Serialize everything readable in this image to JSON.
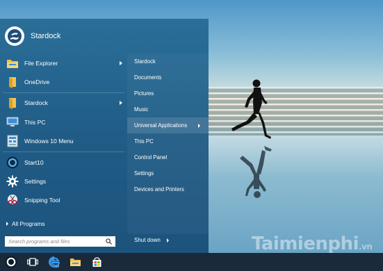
{
  "user": {
    "name": "Stardock"
  },
  "apps": [
    {
      "label": "File Explorer",
      "icon": "file-explorer-icon",
      "has_submenu": true
    },
    {
      "label": "OneDrive",
      "icon": "onedrive-icon",
      "has_submenu": false
    },
    {
      "label": "Stardock",
      "icon": "folder-icon",
      "has_submenu": true
    },
    {
      "label": "This PC",
      "icon": "this-pc-icon",
      "has_submenu": false
    },
    {
      "label": "Windows 10 Menu",
      "icon": "windows-10-menu-icon",
      "has_submenu": false
    },
    {
      "label": "Start10",
      "icon": "start10-icon",
      "has_submenu": false
    },
    {
      "label": "Settings",
      "icon": "settings-gear-icon",
      "has_submenu": false
    },
    {
      "label": "Snipping Tool",
      "icon": "snipping-tool-icon",
      "has_submenu": false
    }
  ],
  "all_programs_label": "All Programs",
  "search": {
    "placeholder": "Search programs and files"
  },
  "places": [
    {
      "label": "Stardock"
    },
    {
      "label": "Documents"
    },
    {
      "label": "Pictures"
    },
    {
      "label": "Music"
    },
    {
      "label": "Universal Applications",
      "has_submenu": true,
      "highlighted": true
    },
    {
      "label": "This PC"
    },
    {
      "label": "Control Panel"
    },
    {
      "label": "Settings"
    },
    {
      "label": "Devices and Printers"
    }
  ],
  "shutdown_label": "Shut down",
  "taskbar": [
    {
      "icon": "start-orb-icon"
    },
    {
      "icon": "task-view-icon"
    },
    {
      "icon": "edge-browser-icon"
    },
    {
      "icon": "file-explorer-icon"
    },
    {
      "icon": "store-icon"
    }
  ],
  "watermark": {
    "main": "Taimienphi",
    "suffix": ".vn"
  },
  "colors": {
    "menu_bg": "#205c86",
    "taskbar_bg": "#1a2a3a",
    "accent": "#2a6f99"
  }
}
